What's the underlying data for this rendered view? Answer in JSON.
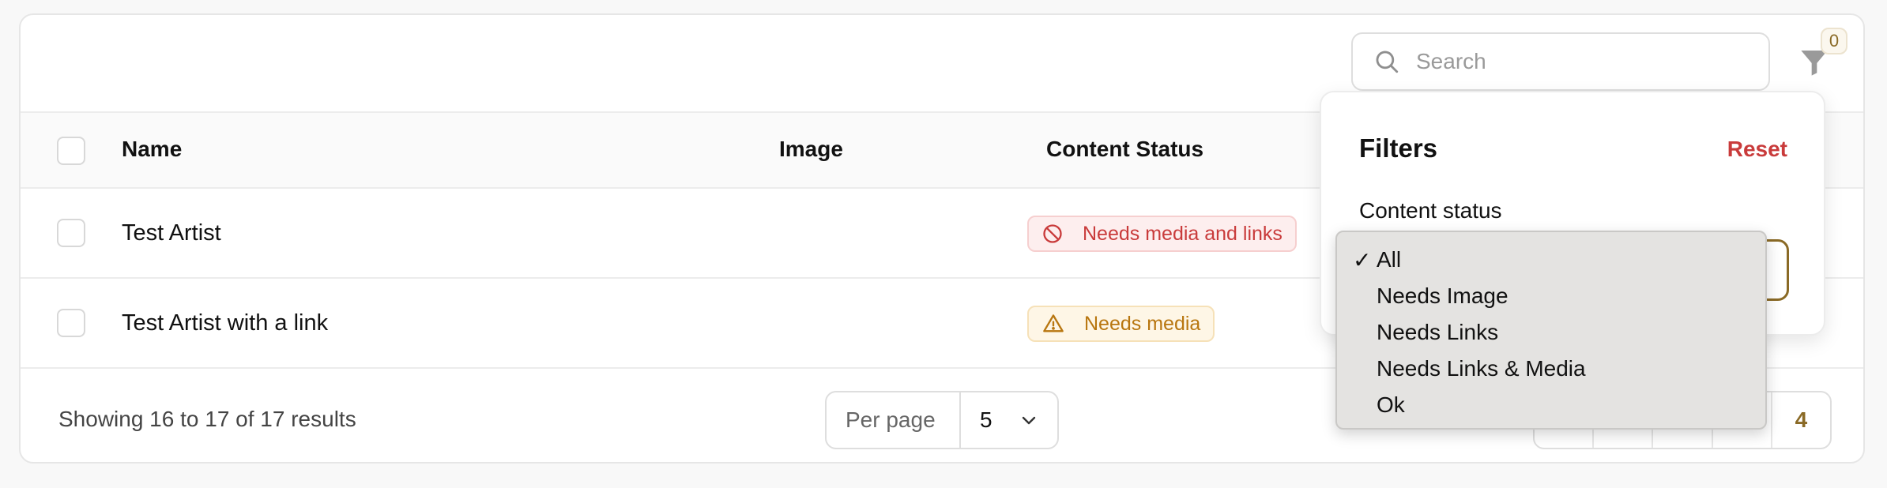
{
  "toolbar": {
    "search_placeholder": "Search",
    "filter_count": "0"
  },
  "table": {
    "columns": [
      "Name",
      "Image",
      "Content Status"
    ],
    "rows": [
      {
        "name": "Test Artist",
        "status": "Needs media and links",
        "status_kind": "danger",
        "status_icon": "ban-icon"
      },
      {
        "name": "Test Artist with a link",
        "status": "Needs media",
        "status_kind": "warning",
        "status_icon": "warning-triangle-icon"
      }
    ]
  },
  "footer": {
    "results_text": "Showing 16 to 17 of 17 results",
    "per_page_label": "Per page",
    "per_page_value": "5",
    "current_page": "4"
  },
  "filters": {
    "title": "Filters",
    "reset_label": "Reset",
    "content_status_label": "Content status",
    "options": [
      "All",
      "Needs Image",
      "Needs Links",
      "Needs Links & Media",
      "Ok"
    ],
    "selected": "All",
    "check_mark": "✓"
  },
  "colors": {
    "accent": "#8a6a26",
    "danger": "#c93b3b",
    "warning": "#b8760f"
  }
}
